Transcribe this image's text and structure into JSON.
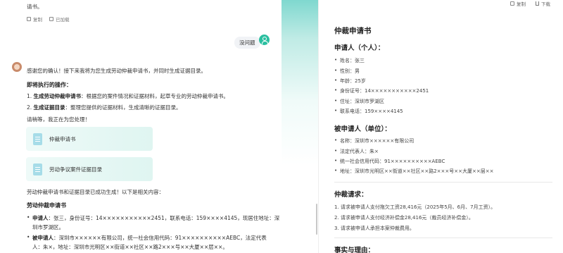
{
  "chat": {
    "prev_text": "请书。",
    "prev_actions": {
      "copy": "复制",
      "saved": "已加载"
    },
    "user_message": "没问题",
    "bot": {
      "intro": "感谢您的确认！接下来我将为您生成劳动仲裁申请书，并同时生成证据目录。",
      "next_heading": "即将执行的操作：",
      "steps": [
        {
          "num": "1.",
          "bold": "生成劳动仲裁申请书",
          "rest": "：根据您的案件情况和证据材料，起草专业的劳动仲裁申请书。"
        },
        {
          "num": "2.",
          "bold": "生成证据目录",
          "rest": "：整理您提供的证据材料，生成清晰的证据目录。"
        }
      ],
      "wait": "请稍等，我正在为您处理！",
      "cards": [
        "仲裁申请书",
        "劳动争议案件证据目录"
      ],
      "done": "劳动仲裁申请书和证据目录已成功生成！以下是相关内容：",
      "sub_heading": "劳动仲裁申请书",
      "applicant": {
        "bold": "申请人",
        "line1": "：张三，身份证号：14×××××××××××2451，联系电话：159××××4145，现居住地址：深",
        "line2": "圳市罗湖区。"
      },
      "respondent": {
        "bold": "被申请人",
        "line1": "：深圳市××××××有限公司，统一社会信用代码：91××××××××××AEBC，法定代表",
        "line2": "人：朱×，地址：深圳市光明区××街道××社区××路2×××号××大厦××层××。"
      }
    }
  },
  "doc": {
    "toolbar": {
      "copy": "复制",
      "download": "下载"
    },
    "title": "仲裁申请书",
    "applicant_heading": "申请人（个人）：",
    "applicant_items": [
      "姓名：张三",
      "性别：男",
      "年龄：25岁",
      "身份证号：14×××××××××××2451",
      "住址：深圳市罗湖区",
      "联系电话：159××××4145"
    ],
    "respondent_heading": "被申请人（单位）：",
    "respondent_items": [
      "名称：深圳市××××××有限公司",
      "法定代表人：朱×",
      "统一社会信用代码：91××××××××××AEBC",
      "地址：深圳市光明区××街道××社区××路2×××号××大厦××层××"
    ],
    "claims_heading": "仲裁请求：",
    "claims": [
      "1. 请求被申请人支付拖欠工资28,416元（2025年5月、6月、7月工资）。",
      "2. 请求被申请人支付经济补偿金28,416元（裁员经济补偿金）。",
      "3. 请求被申请人承担本案仲裁费用。"
    ],
    "facts_heading": "事实与理由："
  }
}
